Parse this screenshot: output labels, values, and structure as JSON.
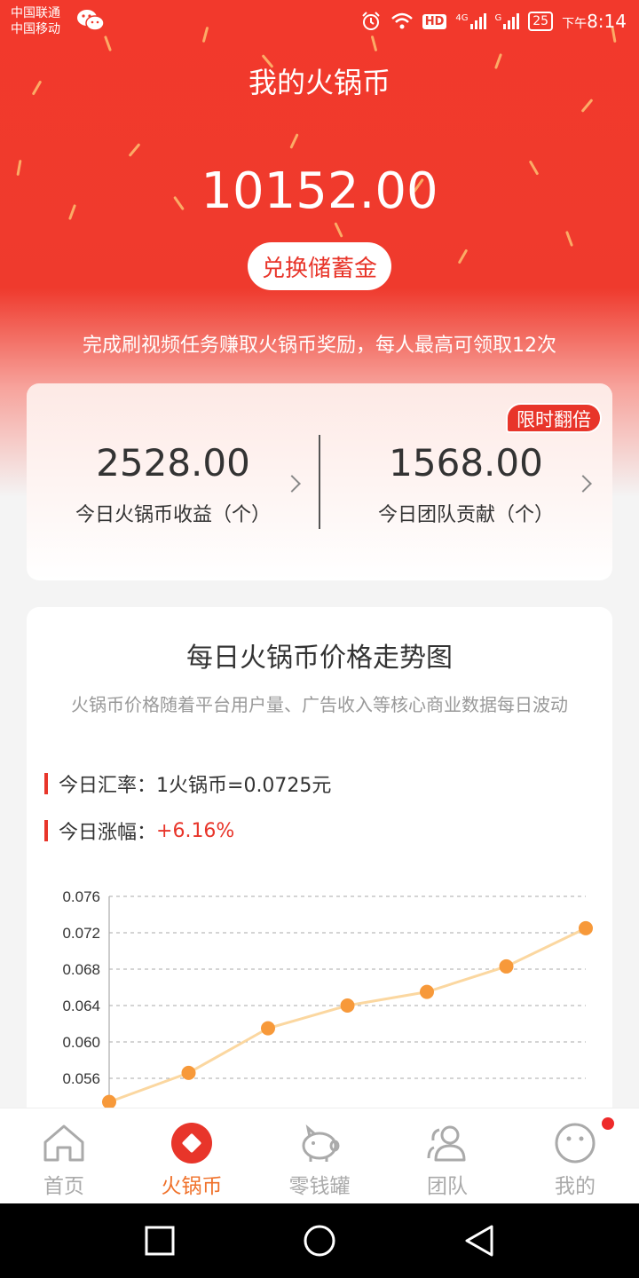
{
  "status_bar": {
    "carrier_1": "中国联通",
    "carrier_2": "中国移动",
    "hd": "HD",
    "network_1": "4G",
    "network_2": "G",
    "battery": "25",
    "time_prefix": "下午",
    "time": "8:14"
  },
  "header": {
    "title": "我的火锅币",
    "balance": "10152.00",
    "exchange_label": "兑换储蓄金",
    "note": "完成刷视频任务赚取火锅币奖励，每人最高可领取12次"
  },
  "stats": {
    "badge": "限时翻倍",
    "today_income": {
      "value": "2528.00",
      "label": "今日火锅币收益（个）"
    },
    "team_contribution": {
      "value": "1568.00",
      "label": "今日团队贡献（个）"
    }
  },
  "price_card": {
    "title": "每日火锅币价格走势图",
    "subtitle": "火锅币价格随着平台用户量、广告收入等核心商业数据每日波动",
    "rate_label": "今日汇率：",
    "rate_value": "1火锅币=0.0725元",
    "change_label": "今日涨幅：",
    "change_value": "+6.16%",
    "accent_color": "#e8352a"
  },
  "chart_data": {
    "type": "line",
    "title": "",
    "xlabel": "",
    "ylabel": "",
    "ylim": [
      0.052,
      0.076
    ],
    "yticks": [
      "0.076",
      "0.072",
      "0.068",
      "0.064",
      "0.060",
      "0.056"
    ],
    "grid": true,
    "series": [
      {
        "values": [
          0.0534,
          0.0566,
          0.0615,
          0.064,
          0.0655,
          0.0683,
          0.0725
        ]
      }
    ],
    "line_color": "#fbd7a0",
    "point_color": "#f7993a"
  },
  "tabbar": {
    "items": [
      {
        "label": "首页",
        "icon": "home-icon"
      },
      {
        "label": "火锅币",
        "icon": "coin-icon",
        "active": true
      },
      {
        "label": "零钱罐",
        "icon": "piggy-bank-icon"
      },
      {
        "label": "团队",
        "icon": "team-icon"
      },
      {
        "label": "我的",
        "icon": "profile-icon",
        "notification": true
      }
    ],
    "active_color": "#f0712a"
  },
  "system_nav": {
    "buttons": [
      "square-icon",
      "circle-icon",
      "triangle-back-icon"
    ]
  }
}
